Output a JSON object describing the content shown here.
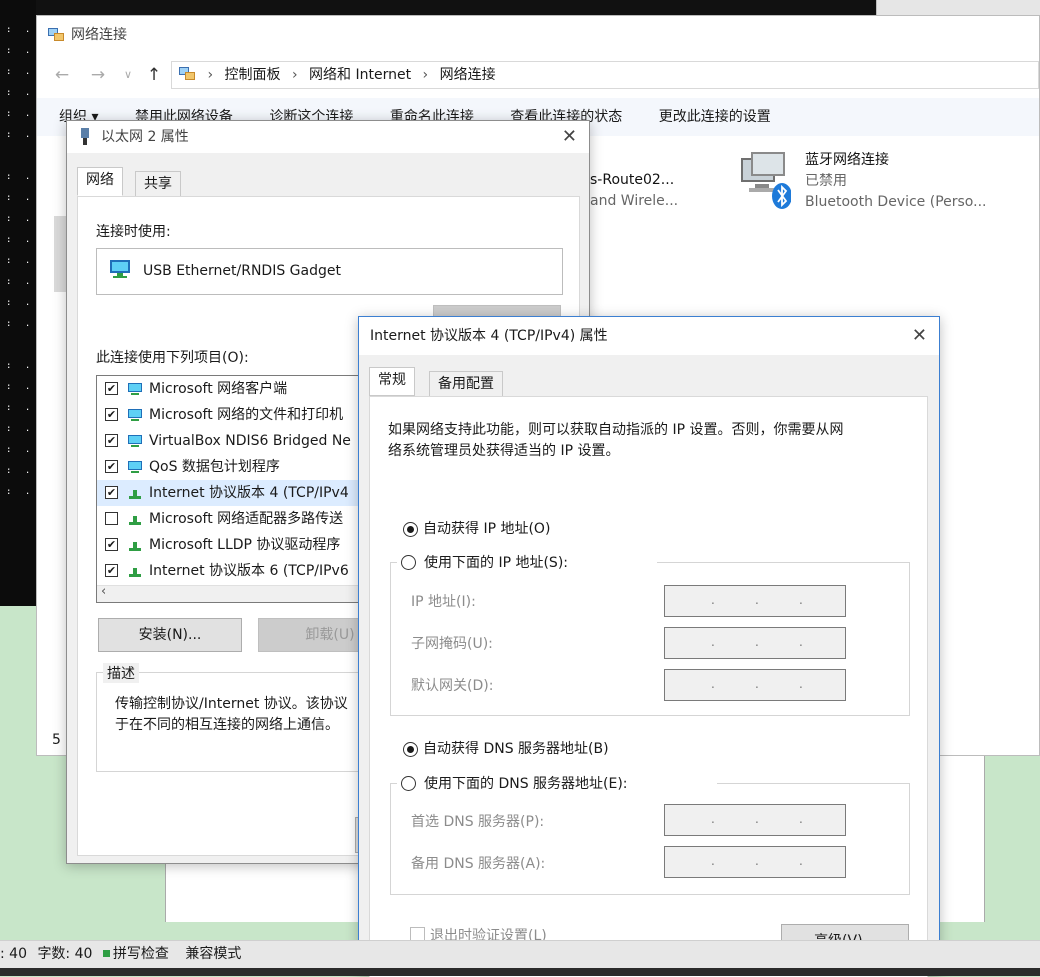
{
  "network_window": {
    "title": "网络连接",
    "address_path": [
      "控制面板",
      "网络和 Internet",
      "网络连接"
    ],
    "toolbar": [
      "组织 ▾",
      "禁用此网络设备",
      "诊断这个连接",
      "重命名此连接",
      "查看此连接的状态",
      "更改此连接的设置"
    ],
    "partial_adapter": {
      "line1": "s-Route02...",
      "line2": "and Wirele..."
    },
    "bluetooth_adapter": {
      "name": "蓝牙网络连接",
      "status": "已禁用",
      "device": "Bluetooth Device (Perso..."
    },
    "left_number": "5"
  },
  "ethernet_dialog": {
    "title": "以太网 2 属性",
    "tabs": [
      "网络",
      "共享"
    ],
    "connect_using_label": "连接时使用:",
    "device_name": "USB Ethernet/RNDIS Gadget",
    "items_label": "此连接使用下列项目(O):",
    "items": [
      {
        "label": "Microsoft 网络客户端",
        "checked": true,
        "selected": false
      },
      {
        "label": "Microsoft 网络的文件和打印机",
        "checked": true,
        "selected": false
      },
      {
        "label": "VirtualBox NDIS6 Bridged Ne",
        "checked": true,
        "selected": false
      },
      {
        "label": "QoS 数据包计划程序",
        "checked": true,
        "selected": false
      },
      {
        "label": "Internet 协议版本 4 (TCP/IPv4",
        "checked": true,
        "selected": true
      },
      {
        "label": "Microsoft 网络适配器多路传送",
        "checked": false,
        "selected": false
      },
      {
        "label": "Microsoft LLDP 协议驱动程序",
        "checked": true,
        "selected": false
      },
      {
        "label": "Internet 协议版本 6 (TCP/IPv6",
        "checked": true,
        "selected": false
      }
    ],
    "install_button": "安装(N)...",
    "uninstall_button": "卸载(U)",
    "description_title": "描述",
    "description_text1": "传输控制协议/Internet 协议。该协议",
    "description_text2": "于在不同的相互连接的网络上通信。"
  },
  "ipv4_dialog": {
    "title": "Internet 协议版本 4 (TCP/IPv4) 属性",
    "tabs": [
      "常规",
      "备用配置"
    ],
    "intro1": "如果网络支持此功能，则可以获取自动指派的 IP 设置。否则，你需要从网",
    "intro2": "络系统管理员处获得适当的 IP 设置。",
    "auto_ip": "自动获得 IP 地址(O)",
    "manual_ip": "使用下面的 IP 地址(S):",
    "ip_address_label": "IP 地址(I):",
    "subnet_label": "子网掩码(U):",
    "gateway_label": "默认网关(D):",
    "auto_dns": "自动获得 DNS 服务器地址(B)",
    "manual_dns": "使用下面的 DNS 服务器地址(E):",
    "preferred_dns_label": "首选 DNS 服务器(P):",
    "alternate_dns_label": "备用 DNS 服务器(A):",
    "ip_dot": ".",
    "validate_label": "退出时验证设置(L)",
    "advanced_button": "高级(V)...",
    "ip_mode": "auto",
    "dns_mode": "auto"
  },
  "statusbar": {
    "lines": ": 40",
    "chars": "字数: 40",
    "spellcheck": "拼写检查",
    "compat": "兼容模式"
  },
  "colors": {
    "accent": "#3c7fd1",
    "selection": "#dcecff",
    "bg_desktop": "#c8e6c9"
  }
}
